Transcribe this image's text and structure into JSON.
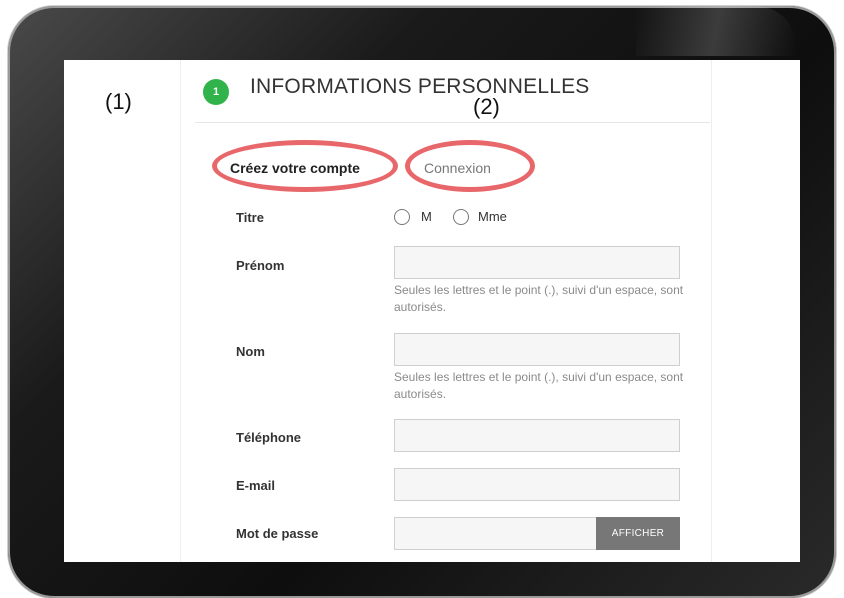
{
  "section": {
    "step": "1",
    "title": "INFORMATIONS PERSONNELLES"
  },
  "tabs": {
    "create": "Créez votre compte",
    "login": "Connexion"
  },
  "annotations": {
    "one": "(1)",
    "two": "(2)"
  },
  "form": {
    "title_label": "Titre",
    "title_options": [
      "M",
      "Mme"
    ],
    "first_name_label": "Prénom",
    "first_name_hint": "Seules les lettres et le point (.), suivi d'un espace, sont autorisés.",
    "last_name_label": "Nom",
    "last_name_hint": "Seules les lettres et le point (.), suivi d'un espace, sont autorisés.",
    "phone_label": "Téléphone",
    "email_label": "E-mail",
    "password_label": "Mot de passe",
    "show_button": "AFFICHER"
  },
  "colors": {
    "badge": "#2fb34a",
    "highlight": "#e8676a",
    "button": "#777777"
  }
}
